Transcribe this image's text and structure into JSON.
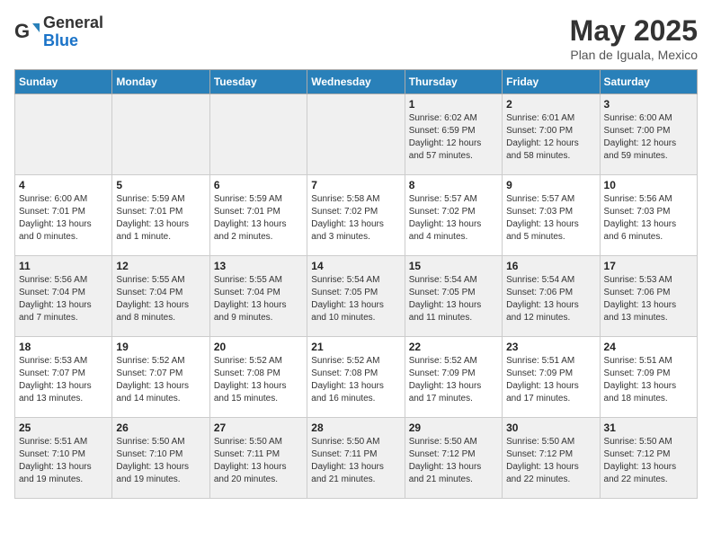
{
  "header": {
    "logo_general": "General",
    "logo_blue": "Blue",
    "title": "May 2025",
    "subtitle": "Plan de Iguala, Mexico"
  },
  "weekdays": [
    "Sunday",
    "Monday",
    "Tuesday",
    "Wednesday",
    "Thursday",
    "Friday",
    "Saturday"
  ],
  "weeks": [
    [
      {
        "day": "",
        "info": ""
      },
      {
        "day": "",
        "info": ""
      },
      {
        "day": "",
        "info": ""
      },
      {
        "day": "",
        "info": ""
      },
      {
        "day": "1",
        "info": "Sunrise: 6:02 AM\nSunset: 6:59 PM\nDaylight: 12 hours\nand 57 minutes."
      },
      {
        "day": "2",
        "info": "Sunrise: 6:01 AM\nSunset: 7:00 PM\nDaylight: 12 hours\nand 58 minutes."
      },
      {
        "day": "3",
        "info": "Sunrise: 6:00 AM\nSunset: 7:00 PM\nDaylight: 12 hours\nand 59 minutes."
      }
    ],
    [
      {
        "day": "4",
        "info": "Sunrise: 6:00 AM\nSunset: 7:01 PM\nDaylight: 13 hours\nand 0 minutes."
      },
      {
        "day": "5",
        "info": "Sunrise: 5:59 AM\nSunset: 7:01 PM\nDaylight: 13 hours\nand 1 minute."
      },
      {
        "day": "6",
        "info": "Sunrise: 5:59 AM\nSunset: 7:01 PM\nDaylight: 13 hours\nand 2 minutes."
      },
      {
        "day": "7",
        "info": "Sunrise: 5:58 AM\nSunset: 7:02 PM\nDaylight: 13 hours\nand 3 minutes."
      },
      {
        "day": "8",
        "info": "Sunrise: 5:57 AM\nSunset: 7:02 PM\nDaylight: 13 hours\nand 4 minutes."
      },
      {
        "day": "9",
        "info": "Sunrise: 5:57 AM\nSunset: 7:03 PM\nDaylight: 13 hours\nand 5 minutes."
      },
      {
        "day": "10",
        "info": "Sunrise: 5:56 AM\nSunset: 7:03 PM\nDaylight: 13 hours\nand 6 minutes."
      }
    ],
    [
      {
        "day": "11",
        "info": "Sunrise: 5:56 AM\nSunset: 7:04 PM\nDaylight: 13 hours\nand 7 minutes."
      },
      {
        "day": "12",
        "info": "Sunrise: 5:55 AM\nSunset: 7:04 PM\nDaylight: 13 hours\nand 8 minutes."
      },
      {
        "day": "13",
        "info": "Sunrise: 5:55 AM\nSunset: 7:04 PM\nDaylight: 13 hours\nand 9 minutes."
      },
      {
        "day": "14",
        "info": "Sunrise: 5:54 AM\nSunset: 7:05 PM\nDaylight: 13 hours\nand 10 minutes."
      },
      {
        "day": "15",
        "info": "Sunrise: 5:54 AM\nSunset: 7:05 PM\nDaylight: 13 hours\nand 11 minutes."
      },
      {
        "day": "16",
        "info": "Sunrise: 5:54 AM\nSunset: 7:06 PM\nDaylight: 13 hours\nand 12 minutes."
      },
      {
        "day": "17",
        "info": "Sunrise: 5:53 AM\nSunset: 7:06 PM\nDaylight: 13 hours\nand 13 minutes."
      }
    ],
    [
      {
        "day": "18",
        "info": "Sunrise: 5:53 AM\nSunset: 7:07 PM\nDaylight: 13 hours\nand 13 minutes."
      },
      {
        "day": "19",
        "info": "Sunrise: 5:52 AM\nSunset: 7:07 PM\nDaylight: 13 hours\nand 14 minutes."
      },
      {
        "day": "20",
        "info": "Sunrise: 5:52 AM\nSunset: 7:08 PM\nDaylight: 13 hours\nand 15 minutes."
      },
      {
        "day": "21",
        "info": "Sunrise: 5:52 AM\nSunset: 7:08 PM\nDaylight: 13 hours\nand 16 minutes."
      },
      {
        "day": "22",
        "info": "Sunrise: 5:52 AM\nSunset: 7:09 PM\nDaylight: 13 hours\nand 17 minutes."
      },
      {
        "day": "23",
        "info": "Sunrise: 5:51 AM\nSunset: 7:09 PM\nDaylight: 13 hours\nand 17 minutes."
      },
      {
        "day": "24",
        "info": "Sunrise: 5:51 AM\nSunset: 7:09 PM\nDaylight: 13 hours\nand 18 minutes."
      }
    ],
    [
      {
        "day": "25",
        "info": "Sunrise: 5:51 AM\nSunset: 7:10 PM\nDaylight: 13 hours\nand 19 minutes."
      },
      {
        "day": "26",
        "info": "Sunrise: 5:50 AM\nSunset: 7:10 PM\nDaylight: 13 hours\nand 19 minutes."
      },
      {
        "day": "27",
        "info": "Sunrise: 5:50 AM\nSunset: 7:11 PM\nDaylight: 13 hours\nand 20 minutes."
      },
      {
        "day": "28",
        "info": "Sunrise: 5:50 AM\nSunset: 7:11 PM\nDaylight: 13 hours\nand 21 minutes."
      },
      {
        "day": "29",
        "info": "Sunrise: 5:50 AM\nSunset: 7:12 PM\nDaylight: 13 hours\nand 21 minutes."
      },
      {
        "day": "30",
        "info": "Sunrise: 5:50 AM\nSunset: 7:12 PM\nDaylight: 13 hours\nand 22 minutes."
      },
      {
        "day": "31",
        "info": "Sunrise: 5:50 AM\nSunset: 7:12 PM\nDaylight: 13 hours\nand 22 minutes."
      }
    ]
  ]
}
